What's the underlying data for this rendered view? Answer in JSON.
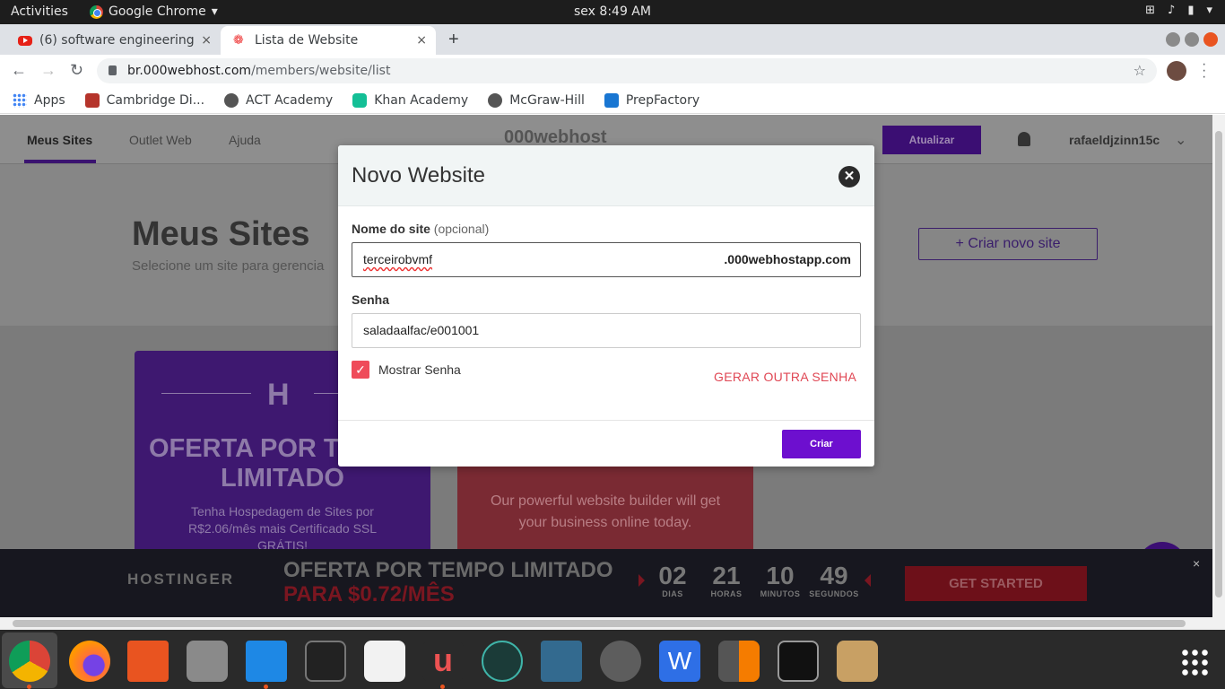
{
  "topbar": {
    "activities": "Activities",
    "app": "Google Chrome",
    "clock": "sex  8:49 AM"
  },
  "tabs": [
    {
      "title": "(6) software engineering",
      "close": "×"
    },
    {
      "title": "Lista de Website",
      "close": "×"
    }
  ],
  "newtab": "+",
  "address": {
    "host": "br.000webhost.com",
    "path": "/members/website/list"
  },
  "bookmarks": [
    "Apps",
    "Cambridge Di...",
    "ACT Academy",
    "Khan Academy",
    "McGraw-Hill",
    "PrepFactory"
  ],
  "site": {
    "nav": [
      "Meus Sites",
      "Outlet Web",
      "Ajuda"
    ],
    "brand": "000webhost",
    "upgrade": "Atualizar",
    "user": "rafaeldjzinn15c",
    "title": "Meus Sites",
    "subtitle": "Selecione um site para gerencia",
    "create": "+  Criar novo site",
    "card1": {
      "title": "OFERTA POR TEMPO LIMITADO",
      "text": "Tenha Hospedagem de Sites por R$2.06/mês mais Certificado SSL GRÁTIS!"
    },
    "card2": {
      "text": "Our powerful website builder will get your business online today."
    }
  },
  "banner": {
    "brand": "HOSTINGER",
    "line1": "OFERTA POR TEMPO LIMITADO",
    "line2": "PARA $0.72/MÊS",
    "countdown": [
      {
        "n": "02",
        "u": "DIAS"
      },
      {
        "n": "21",
        "u": "HORAS"
      },
      {
        "n": "10",
        "u": "MINUTOS"
      },
      {
        "n": "49",
        "u": "SEGUNDOS"
      }
    ],
    "cta": "GET STARTED",
    "close": "×"
  },
  "modal": {
    "title": "Novo Website",
    "name_label": "Nome do site",
    "name_optional": "(opcional)",
    "name_value": "terceirobvmf",
    "name_suffix": ".000webhostapp.com",
    "password_label": "Senha",
    "password_value": "saladaalfac/e001001",
    "show_password": "Mostrar Senha",
    "generate": "GERAR OUTRA SENHA",
    "submit": "Criar"
  }
}
